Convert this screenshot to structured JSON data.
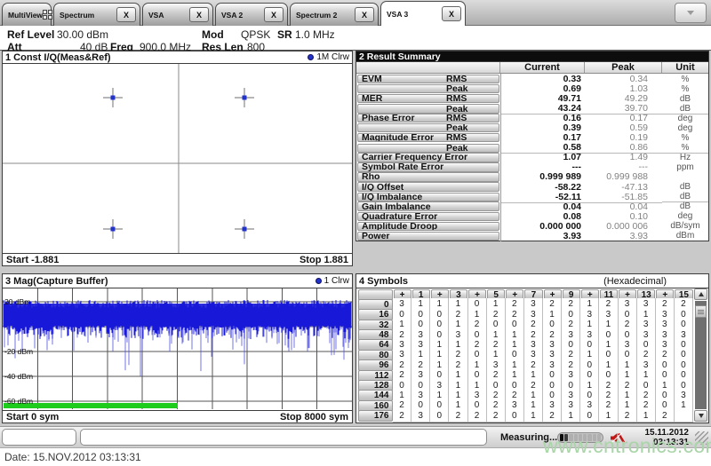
{
  "tabs": {
    "close_label": "X",
    "items": [
      {
        "label": "MultiView",
        "icon": "grid-icon",
        "closable": false,
        "active": false
      },
      {
        "label": "Spectrum",
        "closable": true,
        "active": false
      },
      {
        "label": "VSA",
        "closable": true,
        "active": false
      },
      {
        "label": "VSA 2",
        "closable": true,
        "active": false
      },
      {
        "label": "Spectrum 2",
        "closable": true,
        "active": false
      },
      {
        "label": "VSA 3",
        "closable": true,
        "active": true
      }
    ]
  },
  "header": {
    "fields": [
      {
        "label": "Ref Level",
        "value": "30.00 dBm"
      },
      {
        "label": "Mod",
        "value": "QPSK"
      },
      {
        "label": "SR",
        "value": "1.0 MHz"
      },
      {
        "label": "Att",
        "value": "40 dB"
      },
      {
        "label": "Freq",
        "value": "900.0 MHz"
      },
      {
        "label": "Res Len",
        "value": "800"
      }
    ]
  },
  "windows": {
    "const_iq": {
      "title": "1 Const I/Q(Meas&Ref)",
      "legend_label": "1M Clrw",
      "footer_left": "Start -1.881",
      "footer_right": "Stop 1.881"
    },
    "result_summary": {
      "title": "2 Result Summary",
      "columns": [
        "Current",
        "Peak",
        "Unit"
      ],
      "rows": [
        {
          "name": "EVM",
          "sub": "RMS",
          "current": "0.33",
          "peak": "0.34",
          "unit": "%"
        },
        {
          "name": "",
          "sub": "Peak",
          "current": "0.69",
          "peak": "1.03",
          "unit": "%"
        },
        {
          "name": "MER",
          "sub": "RMS",
          "current": "49.71",
          "peak": "49.29",
          "unit": "dB"
        },
        {
          "name": "",
          "sub": "Peak",
          "current": "43.24",
          "peak": "39.70",
          "unit": "dB",
          "sep": true
        },
        {
          "name": "Phase Error",
          "sub": "RMS",
          "current": "0.16",
          "peak": "0.17",
          "unit": "deg"
        },
        {
          "name": "",
          "sub": "Peak",
          "current": "0.39",
          "peak": "0.59",
          "unit": "deg"
        },
        {
          "name": "Magnitude Error",
          "sub": "RMS",
          "current": "0.17",
          "peak": "0.19",
          "unit": "%"
        },
        {
          "name": "",
          "sub": "Peak",
          "current": "0.58",
          "peak": "0.86",
          "unit": "%",
          "sep": true
        },
        {
          "name": "Carrier Frequency Error",
          "sub": "",
          "current": "1.07",
          "peak": "1.49",
          "unit": "Hz"
        },
        {
          "name": "Symbol Rate Error",
          "sub": "",
          "current": "---",
          "peak": "---",
          "unit": "ppm"
        },
        {
          "name": "Rho",
          "sub": "",
          "current": "0.999 989",
          "peak": "0.999 988",
          "unit": ""
        },
        {
          "name": "I/Q Offset",
          "sub": "",
          "current": "-58.22",
          "peak": "-47.13",
          "unit": "dB"
        },
        {
          "name": "I/Q Imbalance",
          "sub": "",
          "current": "-52.11",
          "peak": "-51.85",
          "unit": "dB",
          "sep": true
        },
        {
          "name": "Gain Imbalance",
          "sub": "",
          "current": "0.04",
          "peak": "0.04",
          "unit": "dB"
        },
        {
          "name": "Quadrature Error",
          "sub": "",
          "current": "0.08",
          "peak": "0.10",
          "unit": "deg"
        },
        {
          "name": "Amplitude Droop",
          "sub": "",
          "current": "0.000 000",
          "peak": "0.000 006",
          "unit": "dB/sym"
        },
        {
          "name": "Power",
          "sub": "",
          "current": "3.93",
          "peak": "3.93",
          "unit": "dBm"
        }
      ]
    },
    "mag": {
      "title": "3 Mag(Capture Buffer)",
      "legend_label": "1 Clrw",
      "y_ticks": [
        "20 dBm",
        "-20 dBm",
        "-40 dBm",
        "-60 dBm"
      ],
      "y_gridlines_dbm": [
        20,
        0,
        -20,
        -40,
        -60
      ],
      "footer_left": "Start 0 sym",
      "footer_right": "Stop 8000 sym"
    },
    "symbols": {
      "title": "4 Symbols",
      "subtitle": "(Hexadecimal)",
      "col_headers": [
        "+",
        "1",
        "+",
        "3",
        "+",
        "5",
        "+",
        "7",
        "+",
        "9",
        "+",
        "11",
        "+",
        "13",
        "+",
        "15"
      ],
      "rows": [
        {
          "label": "0",
          "values": [
            3,
            1,
            1,
            1,
            0,
            1,
            2,
            3,
            2,
            2,
            1,
            2,
            3,
            3,
            2,
            2
          ]
        },
        {
          "label": "16",
          "values": [
            0,
            0,
            0,
            2,
            1,
            2,
            2,
            3,
            1,
            0,
            3,
            3,
            0,
            1,
            3,
            0
          ]
        },
        {
          "label": "32",
          "values": [
            1,
            0,
            0,
            1,
            2,
            0,
            0,
            2,
            0,
            2,
            1,
            1,
            2,
            3,
            3,
            0
          ]
        },
        {
          "label": "48",
          "values": [
            2,
            3,
            0,
            3,
            0,
            1,
            1,
            2,
            2,
            3,
            3,
            0,
            0,
            3,
            3,
            3
          ]
        },
        {
          "label": "64",
          "values": [
            3,
            3,
            1,
            1,
            2,
            2,
            1,
            3,
            3,
            0,
            0,
            1,
            3,
            0,
            3,
            0
          ]
        },
        {
          "label": "80",
          "values": [
            3,
            1,
            1,
            2,
            0,
            1,
            0,
            3,
            3,
            2,
            1,
            0,
            0,
            2,
            2,
            0
          ]
        },
        {
          "label": "96",
          "values": [
            2,
            2,
            1,
            2,
            1,
            3,
            1,
            2,
            3,
            2,
            0,
            1,
            1,
            3,
            0,
            0
          ]
        },
        {
          "label": "112",
          "values": [
            2,
            3,
            0,
            1,
            0,
            2,
            1,
            1,
            0,
            3,
            0,
            0,
            1,
            1,
            0,
            0
          ]
        },
        {
          "label": "128",
          "values": [
            0,
            0,
            3,
            1,
            1,
            0,
            0,
            2,
            0,
            0,
            1,
            2,
            2,
            0,
            1,
            0
          ]
        },
        {
          "label": "144",
          "values": [
            1,
            3,
            1,
            1,
            3,
            2,
            2,
            1,
            0,
            3,
            0,
            2,
            1,
            2,
            0,
            3
          ]
        },
        {
          "label": "160",
          "values": [
            2,
            0,
            0,
            1,
            0,
            2,
            3,
            1,
            3,
            3,
            3,
            2,
            1,
            2,
            0,
            1
          ]
        },
        {
          "label": "176",
          "values": [
            2,
            3,
            0,
            2,
            2,
            2,
            0,
            1,
            2,
            1,
            0,
            1,
            2,
            1,
            2,
            ""
          ]
        }
      ]
    }
  },
  "statusbar": {
    "measuring_label": "Measuring...",
    "progress_segments_total": 9,
    "progress_segments_filled": 2,
    "date": "15.11.2012",
    "time": "03:13:31"
  },
  "footer": {
    "datetime_label": "Date: 15.NOV.2012  03:13:31"
  },
  "watermark": "www.cntronics.com",
  "colors": {
    "trace_blue": "#1818d8",
    "spike_blue": "#5353e2",
    "marker_blue": "#2233cc",
    "green_bar": "#1ecc1e",
    "grid_gray": "#555555",
    "title_focused_bg": "#0d0d0d"
  }
}
